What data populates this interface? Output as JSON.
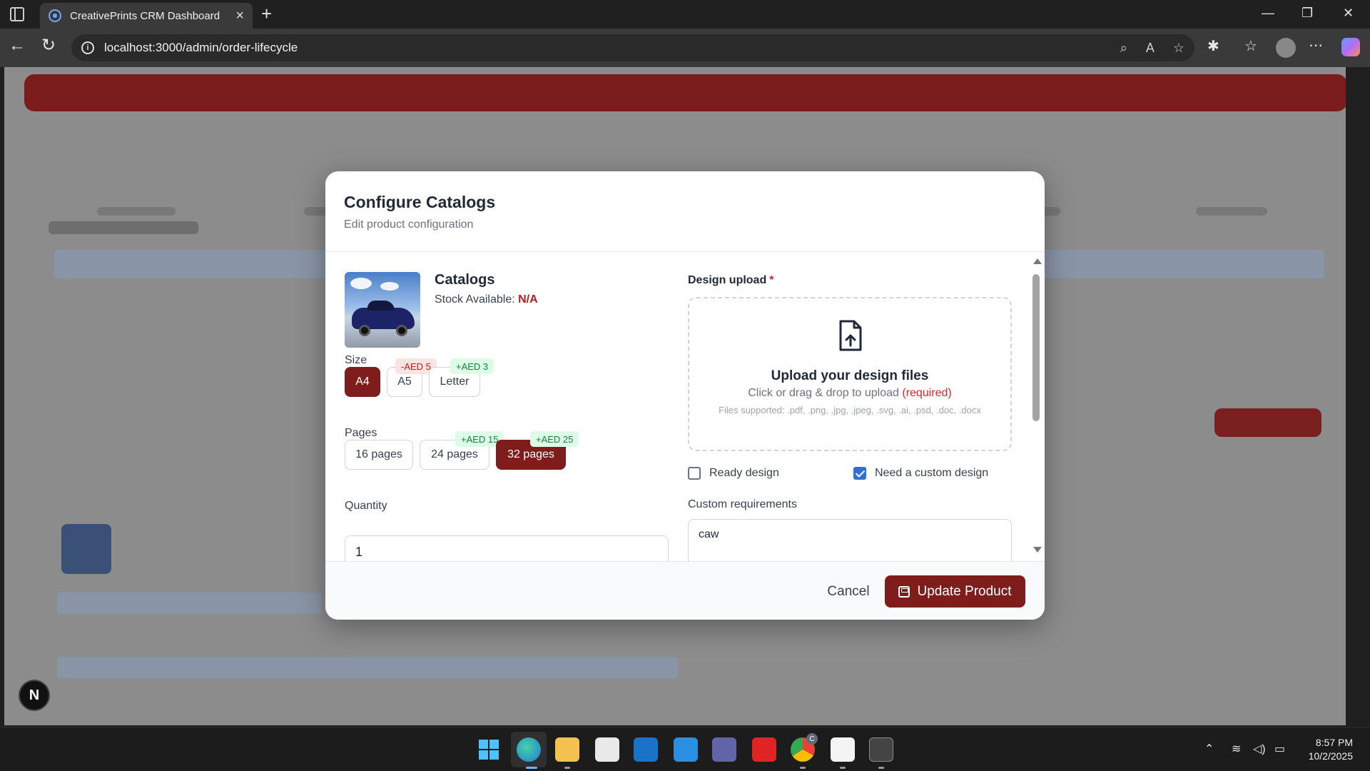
{
  "browser": {
    "tab_title": "CreativePrints CRM Dashboard",
    "url": "localhost:3000/admin/order-lifecycle"
  },
  "modal": {
    "title": "Configure Catalogs",
    "subtitle": "Edit product configuration",
    "product": {
      "name": "Catalogs",
      "stock_label": "Stock Available:",
      "stock_value": "N/A"
    },
    "size": {
      "label": "Size",
      "options": [
        {
          "label": "A4",
          "selected": true,
          "badge": ""
        },
        {
          "label": "A5",
          "selected": false,
          "badge": "-AED 5"
        },
        {
          "label": "Letter",
          "selected": false,
          "badge": "+AED 3"
        }
      ]
    },
    "pages": {
      "label": "Pages",
      "options": [
        {
          "label": "16 pages",
          "selected": false,
          "badge": ""
        },
        {
          "label": "24 pages",
          "selected": false,
          "badge": "+AED 15"
        },
        {
          "label": "32 pages",
          "selected": true,
          "badge": "+AED 25"
        }
      ]
    },
    "quantity": {
      "label": "Quantity",
      "value": "1"
    },
    "design_upload": {
      "label": "Design upload",
      "required_mark": "*",
      "title": "Upload your design files",
      "subtitle": "Click or drag & drop to upload",
      "required_text": "(required)",
      "files_supported": "Files supported: .pdf, .png, .jpg, .jpeg, .svg, .ai, .psd, .doc, .docx"
    },
    "checkboxes": {
      "ready_design": {
        "label": "Ready design",
        "checked": false
      },
      "custom_design": {
        "label": "Need a custom design",
        "checked": true
      }
    },
    "custom_requirements": {
      "label": "Custom requirements",
      "value": "caw"
    },
    "footer": {
      "cancel_label": "Cancel",
      "update_label": "Update Product"
    }
  },
  "page_badge": "N",
  "taskbar": {
    "time": "8:57 PM",
    "date": "10/2/2025",
    "chrome_badge": "C"
  },
  "colors": {
    "accent": "#7f1d1d",
    "required": "#dc2626",
    "positive_badge_bg": "#dcfce7",
    "negative_badge_bg": "#fde2e2",
    "checkbox_checked": "#2f6fd6"
  }
}
